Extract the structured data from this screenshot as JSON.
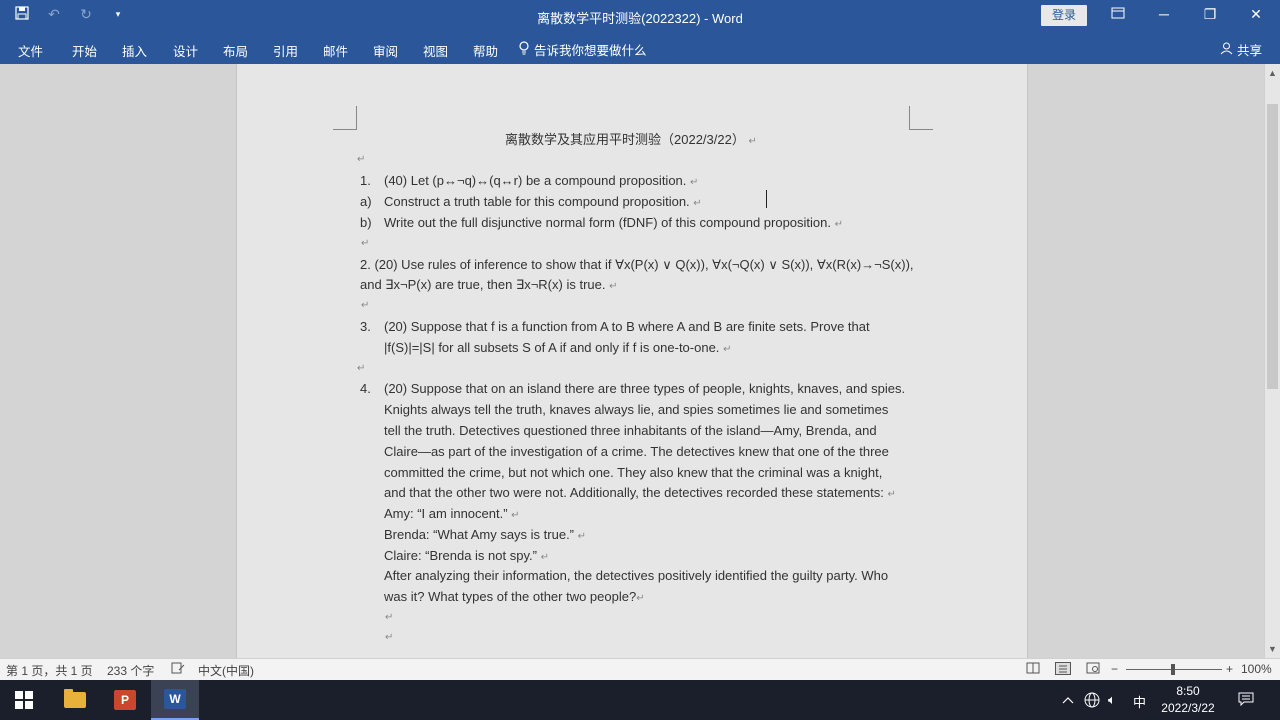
{
  "window": {
    "title": "离散数学平时测验(2022322)  -  Word",
    "login": "登录"
  },
  "quick_access": {
    "icons": [
      "save-icon",
      "undo-icon",
      "redo-icon",
      "customize-icon"
    ]
  },
  "ribbon": {
    "tabs": [
      "文件",
      "开始",
      "插入",
      "设计",
      "布局",
      "引用",
      "邮件",
      "审阅",
      "视图",
      "帮助"
    ],
    "tell_me": "告诉我你想要做什么",
    "share": "共享"
  },
  "document": {
    "title": "离散数学及其应用平时测验（2022/3/22）",
    "q1": {
      "num": "1.",
      "text": "(40) Let (p↔¬q)↔(q↔r)  be  a compound proposition.",
      "a_label": "a)",
      "a_text": "Construct a truth table for this compound proposition.",
      "b_label": "b)",
      "b_text": "Write out the full disjunctive normal form (fDNF) of this compound proposition."
    },
    "q2": {
      "line1": "2. (20) Use rules of inference to show that if  ∀x(P(x) ∨ Q(x)), ∀x(¬Q(x) ∨ S(x)), ∀x(R(x)→¬S(x)),",
      "line2": "and ∃x¬P(x) are true, then ∃x¬R(x) is true."
    },
    "q3": {
      "num": "3.",
      "line1": "(20) Suppose that f is a function from A to B where A and B are finite sets. Prove that",
      "line2": "|f(S)|=|S| for all subsets S of A if and only if f is one-to-one."
    },
    "q4": {
      "num": "4.",
      "lines": [
        "(20) Suppose that on an island there are three types of people, knights, knaves, and spies.",
        "Knights always tell the truth, knaves always lie, and spies sometimes lie and sometimes",
        "tell the truth. Detectives questioned three inhabitants of the island—Amy, Brenda, and",
        "Claire—as part of the investigation of a crime. The detectives knew that one of the three",
        "committed the crime, but not which one. They also knew that the criminal was a knight,",
        "and that the other two were not. Additionally, the detectives recorded these statements:",
        "Amy:    “I am innocent.”",
        "Brenda: “What Amy says is true.”",
        "Claire:  “Brenda is not spy.”",
        "After analyzing their information, the detectives positively identified the guilty party. Who",
        "was it? What types of the other two people?"
      ]
    },
    "paragraph_mark": "↵"
  },
  "status_bar": {
    "page": "第 1 页，共 1 页",
    "words": "233 个字",
    "language": "中文(中国)",
    "zoom": "100%",
    "zoom_minus": "−",
    "zoom_plus": "+"
  },
  "taskbar": {
    "time": "8:50",
    "date": "2022/3/22",
    "ime": "中"
  }
}
